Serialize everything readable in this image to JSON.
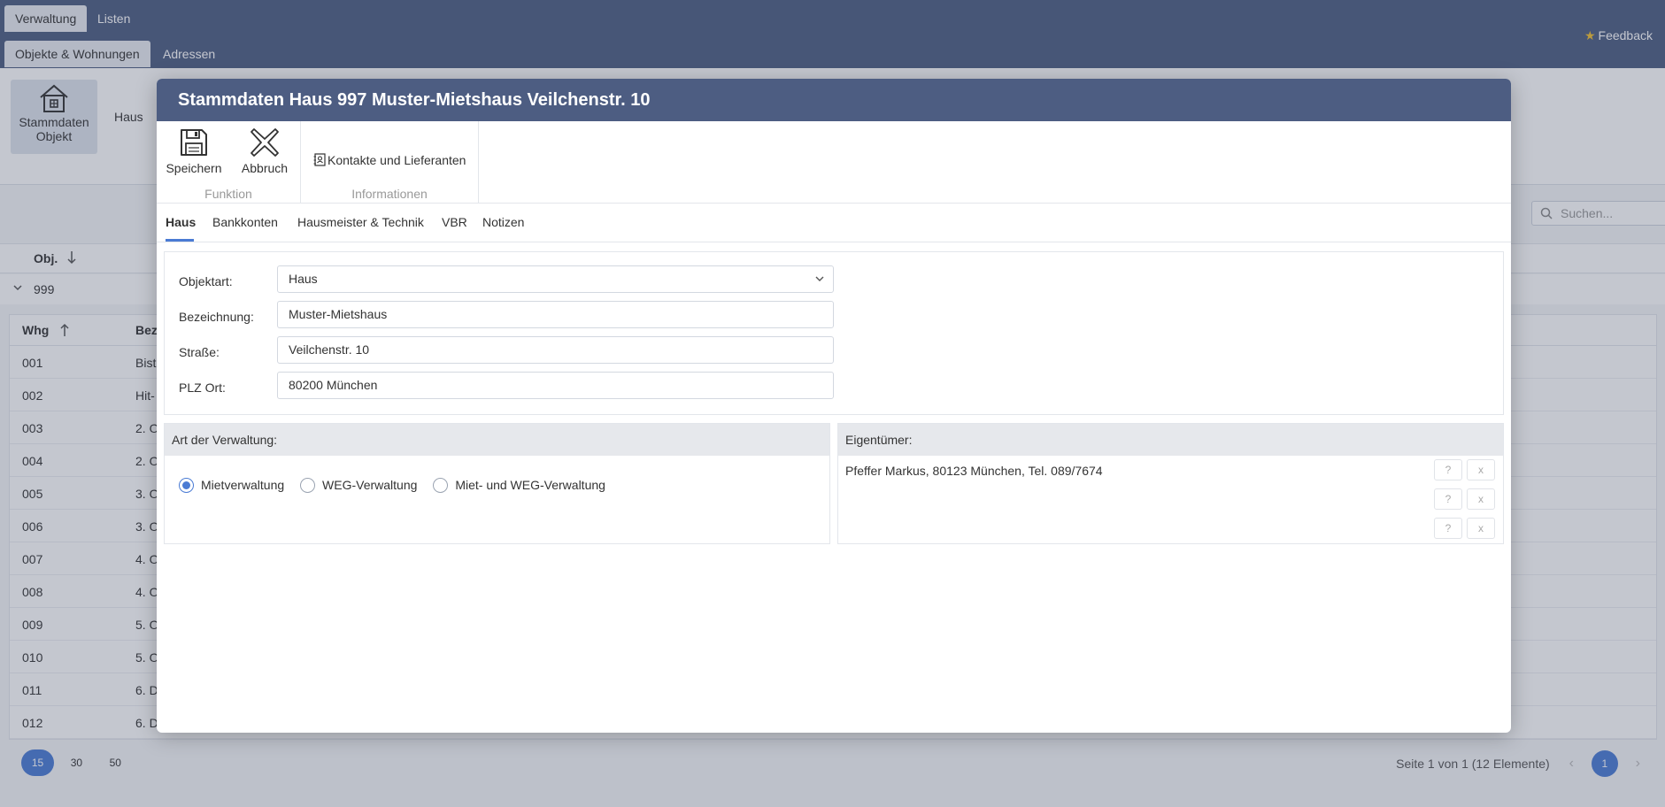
{
  "app": {
    "top_tabs": [
      "Verwaltung",
      "Listen"
    ],
    "sub_tabs": [
      "Objekte & Wohnungen",
      "Adressen"
    ],
    "feedback": "Feedback",
    "ribbon_button": {
      "line1": "Stammdaten",
      "line2": "Objekt"
    },
    "ribbon_haus": "Haus",
    "search_placeholder": "Suchen...",
    "obj_header": "Obj.",
    "obj_value": "999",
    "grid_headers": [
      "Whg",
      "Bez"
    ],
    "grid_rows": [
      {
        "whg": "001",
        "bez": "Bist"
      },
      {
        "whg": "002",
        "bez": "Hit-"
      },
      {
        "whg": "003",
        "bez": "2. O"
      },
      {
        "whg": "004",
        "bez": "2. O"
      },
      {
        "whg": "005",
        "bez": "3. O"
      },
      {
        "whg": "006",
        "bez": "3. O"
      },
      {
        "whg": "007",
        "bez": "4. O"
      },
      {
        "whg": "008",
        "bez": "4. O"
      },
      {
        "whg": "009",
        "bez": "5. O"
      },
      {
        "whg": "010",
        "bez": "5. O"
      },
      {
        "whg": "011",
        "bez": "6. D"
      },
      {
        "whg": "012",
        "bez": "6. D"
      }
    ],
    "page_sizes": [
      "15",
      "30",
      "50"
    ],
    "page_info": "Seite 1 von 1 (12 Elemente)",
    "current_page": "1"
  },
  "dialog": {
    "title": "Stammdaten Haus 997 Muster-Mietshaus Veilchenstr. 10",
    "buttons": {
      "save": "Speichern",
      "cancel": "Abbruch",
      "contacts": "Kontakte und Lieferanten"
    },
    "groups": {
      "funktion": "Funktion",
      "informationen": "Informationen"
    },
    "tabs": [
      "Haus",
      "Bankkonten",
      "Hausmeister & Technik",
      "VBR",
      "Notizen"
    ],
    "form": {
      "objektart_label": "Objektart:",
      "objektart_value": "Haus",
      "bezeichnung_label": "Bezeichnung:",
      "bezeichnung_value": "Muster-Mietshaus",
      "strasse_label": "Straße:",
      "strasse_value": "Veilchenstr. 10",
      "plz_label": "PLZ Ort:",
      "plz_value": "80200 München"
    },
    "verwaltung": {
      "header": "Art der Verwaltung:",
      "options": [
        "Mietverwaltung",
        "WEG-Verwaltung",
        "Miet- und WEG-Verwaltung"
      ],
      "selected": "Mietverwaltung"
    },
    "eigentuemer": {
      "header": "Eigentümer:",
      "entry": "Pfeffer Markus, 80123 München, Tel. 089/7674",
      "help_label": "?",
      "remove_label": "x"
    }
  },
  "colors": {
    "header": "#4d5d82",
    "accent": "#4a7bd4"
  }
}
